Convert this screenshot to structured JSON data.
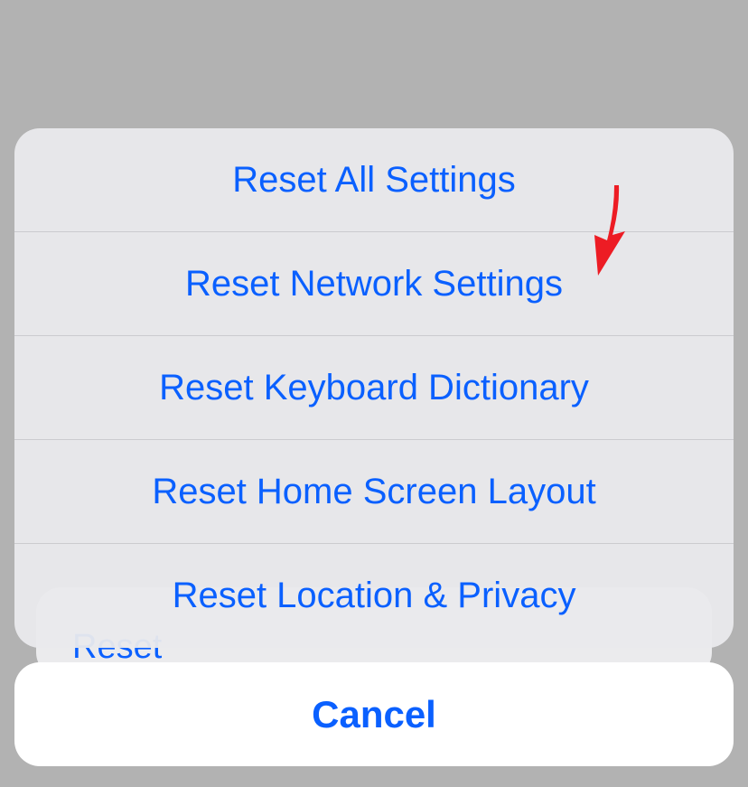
{
  "background": {
    "partial_text": "Reset"
  },
  "actionSheet": {
    "options": [
      {
        "label": "Reset All Settings"
      },
      {
        "label": "Reset Network Settings"
      },
      {
        "label": "Reset Keyboard Dictionary"
      },
      {
        "label": "Reset Home Screen Layout"
      },
      {
        "label": "Reset Location & Privacy"
      }
    ],
    "cancel_label": "Cancel"
  },
  "annotation": {
    "arrow_color": "#ed1c24"
  }
}
